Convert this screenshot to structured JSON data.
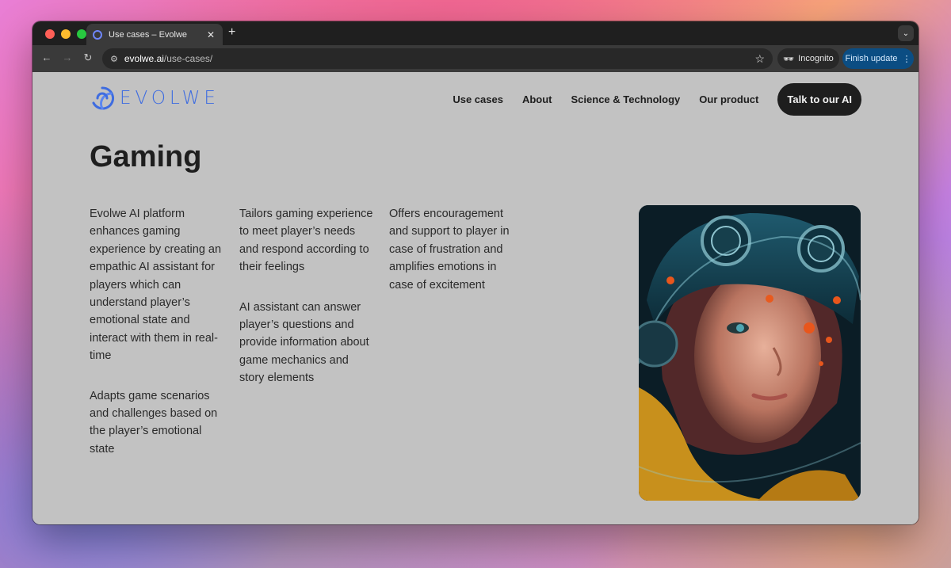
{
  "browser": {
    "tab_title": "Use cases – Evolwe",
    "new_tab_label": "+",
    "url_host": "evolwe.ai",
    "url_path": "/use-cases/",
    "incognito_label": "Incognito",
    "finish_update_label": "Finish update"
  },
  "site": {
    "logo_text": "EVOLWE",
    "nav": [
      "Use cases",
      "About",
      "Science & Technology",
      "Our product"
    ],
    "cta_label": "Talk to our AI"
  },
  "content": {
    "heading": "Gaming",
    "col1": [
      "Evolwe AI platform enhances gaming experience by creating an empathic AI assistant for players which can understand player’s emotional state and interact with them in real-time",
      "Adapts game scenarios and challenges based on the player’s emotional state"
    ],
    "col2": [
      "Tailors gaming experience to meet player’s needs and respond according to their feelings",
      "AI assistant can answer player’s questions and provide information about game mechanics and story elements"
    ],
    "col3": [
      "Offers encouragement and support to player in case of frustration and amplifies emotions in case of excitement"
    ]
  },
  "colors": {
    "brand_blue": "#3e6ce0",
    "page_bg": "#c2c2c2",
    "cta_bg": "#1e1e1e",
    "update_btn": "#0b4d83"
  }
}
